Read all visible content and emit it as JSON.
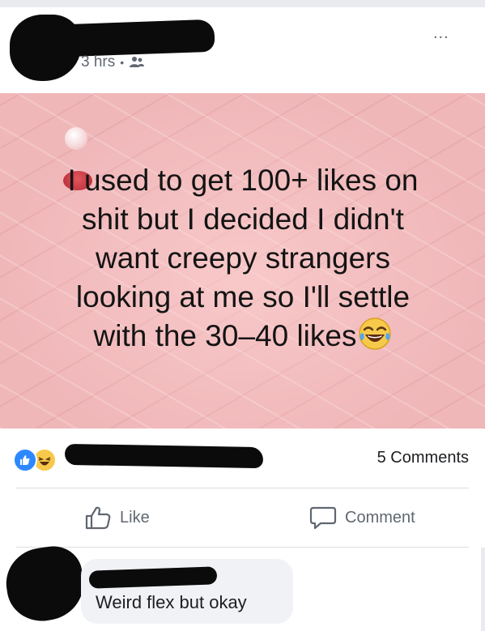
{
  "post": {
    "timestamp": "3 hrs",
    "separator": "•",
    "privacy_icon": "friends-icon",
    "more_label": "...",
    "text_lines": [
      "I used to get 100+ likes on",
      "shit but I decided I didn't",
      "want creepy strangers",
      "looking at me so I'll settle",
      "with the 30–40 likes"
    ],
    "text_emoji": "laughing-tears-icon",
    "background_color": "#f0b7b9"
  },
  "reactions": {
    "icons": [
      "like-reaction-icon",
      "haha-reaction-icon"
    ],
    "comments_count": "5 Comments"
  },
  "actions": {
    "like_label": "Like",
    "comment_label": "Comment"
  },
  "comment": {
    "text": "Weird flex but okay"
  },
  "colors": {
    "accent": "#2d88ff",
    "muted_text": "#606770",
    "bubble": "#f0f2f5"
  }
}
